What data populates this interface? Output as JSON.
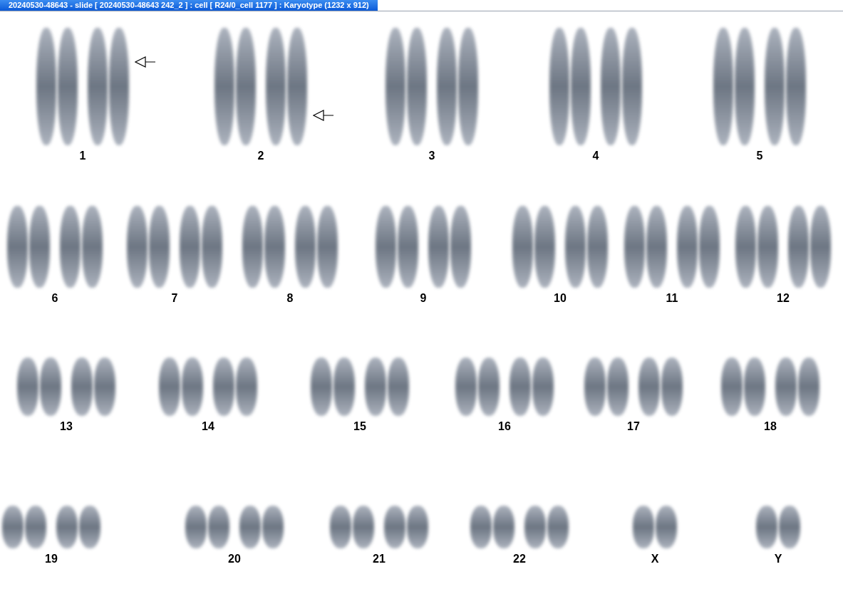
{
  "window": {
    "title": "20240530-48643 - slide [ 20240530-48643 242_2 ] : cell [ R24/0_cell 1177 ] : Karyotype  (1232 x 912)"
  },
  "karyotype": {
    "rows": [
      {
        "groups": [
          {
            "label": "1",
            "kind": "pair",
            "marked_top": true,
            "marked_bottom": false
          },
          {
            "label": "2",
            "kind": "pair",
            "marked_top": false,
            "marked_bottom": true
          },
          {
            "label": "3",
            "kind": "pair",
            "marked_top": false,
            "marked_bottom": false
          },
          {
            "label": "4",
            "kind": "pair",
            "marked_top": false,
            "marked_bottom": false
          },
          {
            "label": "5",
            "kind": "pair",
            "marked_top": false,
            "marked_bottom": false
          }
        ]
      },
      {
        "groups": [
          {
            "label": "6",
            "kind": "pair",
            "marked_top": false,
            "marked_bottom": false
          },
          {
            "label": "7",
            "kind": "pair",
            "marked_top": false,
            "marked_bottom": false
          },
          {
            "label": "8",
            "kind": "pair",
            "marked_top": false,
            "marked_bottom": false
          },
          {
            "label": "9",
            "kind": "pair",
            "marked_top": false,
            "marked_bottom": false
          },
          {
            "label": "10",
            "kind": "pair",
            "marked_top": false,
            "marked_bottom": false
          },
          {
            "label": "11",
            "kind": "pair",
            "marked_top": false,
            "marked_bottom": false
          },
          {
            "label": "12",
            "kind": "pair",
            "marked_top": false,
            "marked_bottom": false
          }
        ]
      },
      {
        "groups": [
          {
            "label": "13",
            "kind": "pair",
            "marked_top": false,
            "marked_bottom": false
          },
          {
            "label": "14",
            "kind": "pair",
            "marked_top": false,
            "marked_bottom": false
          },
          {
            "label": "15",
            "kind": "pair",
            "marked_top": false,
            "marked_bottom": false
          },
          {
            "label": "16",
            "kind": "pair",
            "marked_top": false,
            "marked_bottom": false
          },
          {
            "label": "17",
            "kind": "pair",
            "marked_top": false,
            "marked_bottom": false
          },
          {
            "label": "18",
            "kind": "pair",
            "marked_top": false,
            "marked_bottom": false
          }
        ]
      },
      {
        "groups": [
          {
            "label": "19",
            "kind": "pair",
            "marked_top": false,
            "marked_bottom": false
          },
          {
            "label": "20",
            "kind": "pair",
            "marked_top": false,
            "marked_bottom": false
          },
          {
            "label": "21",
            "kind": "pair",
            "marked_top": false,
            "marked_bottom": false
          },
          {
            "label": "22",
            "kind": "pair",
            "marked_top": false,
            "marked_bottom": false
          },
          {
            "label": "X",
            "kind": "single",
            "marked_top": false,
            "marked_bottom": false
          },
          {
            "label": "Y",
            "kind": "single",
            "marked_top": false,
            "marked_bottom": false
          }
        ]
      }
    ]
  }
}
